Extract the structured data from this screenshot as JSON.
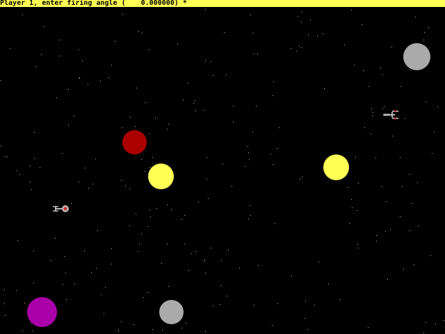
{
  "prompt": {
    "text": "Player 1, enter firing angle (",
    "value": "0.000000)",
    "cursor": "*"
  },
  "colors": {
    "prompt_bar": "#ffff55",
    "background": "#000000",
    "star": "#bbbbbb",
    "ship_hull": "#b8b8b8",
    "ship_accent": "#cc3333"
  },
  "planets": [
    {
      "name": "planet-gray-top-right",
      "color": "#aaaaaa"
    },
    {
      "name": "planet-dark-red",
      "color": "#aa0000"
    },
    {
      "name": "planet-yellow-left",
      "color": "#ffff55"
    },
    {
      "name": "planet-yellow-right",
      "color": "#ffff55"
    },
    {
      "name": "planet-magenta",
      "color": "#aa00aa"
    },
    {
      "name": "planet-gray-bottom",
      "color": "#aaaaaa"
    }
  ],
  "ships": [
    {
      "name": "player-1-ship",
      "icon": "starship-icon"
    },
    {
      "name": "player-2-ship",
      "icon": "starship-icon"
    }
  ]
}
